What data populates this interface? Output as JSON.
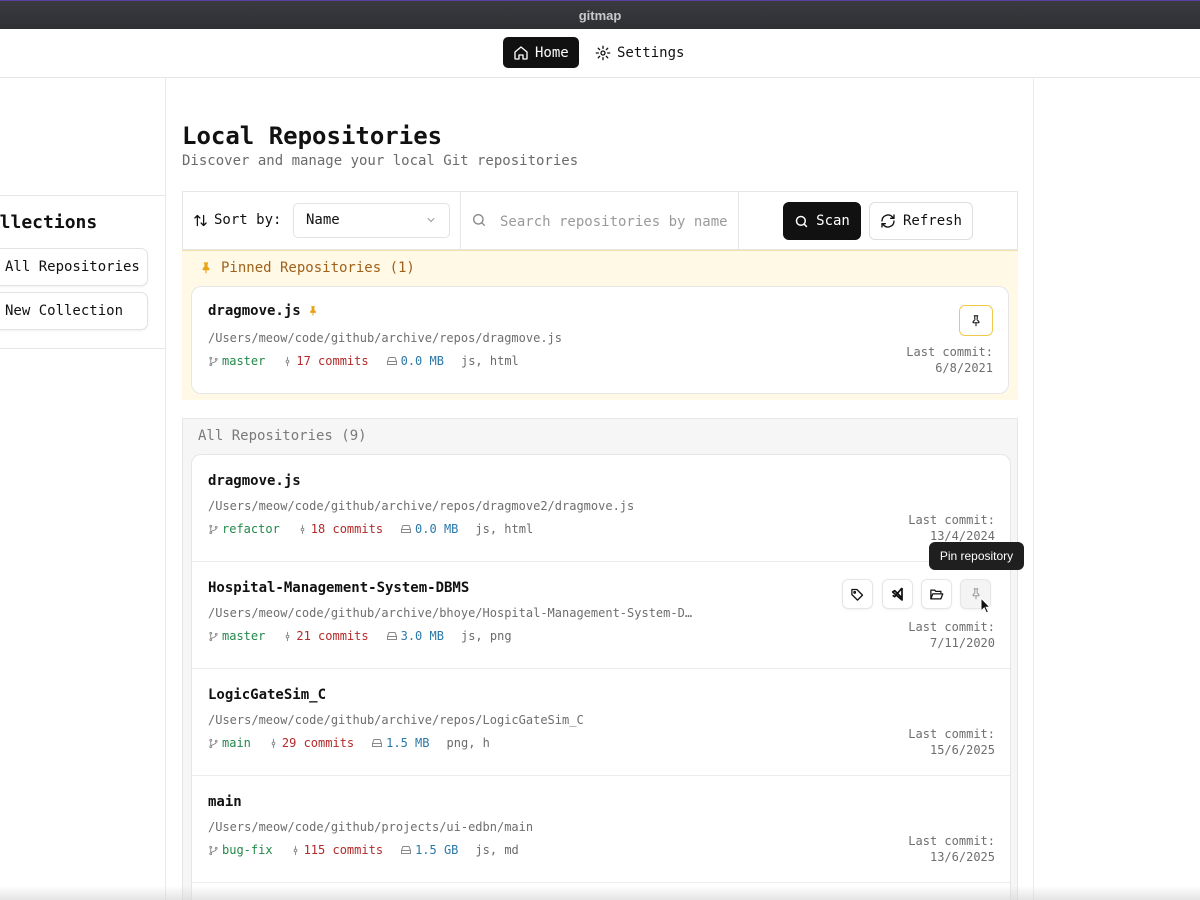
{
  "window": {
    "title": "gitmap"
  },
  "nav": {
    "home": "Home",
    "settings": "Settings"
  },
  "sidebar": {
    "collections_title": "Collections",
    "items": [
      "All Repositories",
      "New Collection"
    ]
  },
  "header": {
    "title": "Local Repositories",
    "subtitle": "Discover and manage your local Git repositories"
  },
  "toolbar": {
    "sort_label": "Sort by:",
    "sort_value": "Name",
    "search_placeholder": "Search repositories by name...",
    "scan_label": "Scan",
    "refresh_label": "Refresh"
  },
  "pinned": {
    "title": "Pinned Repositories (1)",
    "repos": [
      {
        "name": "dragmove.js",
        "path": "/Users/meow/code/github/archive/repos/dragmove.js",
        "branch": "master",
        "commits": "17 commits",
        "size": "0.0 MB",
        "types": "js, html",
        "last_commit_label": "Last commit:",
        "last_commit": "6/8/2021"
      }
    ]
  },
  "all": {
    "title": "All Repositories (9)",
    "repos": [
      {
        "name": "dragmove.js",
        "path": "/Users/meow/code/github/archive/repos/dragmove2/dragmove.js",
        "branch": "refactor",
        "commits": "18 commits",
        "size": "0.0 MB",
        "types": "js, html",
        "last_commit_label": "Last commit:",
        "last_commit": "13/4/2024"
      },
      {
        "name": "Hospital-Management-System-DBMS",
        "path": "/Users/meow/code/github/archive/bhoye/Hospital-Management-System-D…",
        "branch": "master",
        "commits": "21 commits",
        "size": "3.0 MB",
        "types": "js, png",
        "last_commit_label": "Last commit:",
        "last_commit": "7/11/2020"
      },
      {
        "name": "LogicGateSim_C",
        "path": "/Users/meow/code/github/archive/repos/LogicGateSim_C",
        "branch": "main",
        "commits": "29 commits",
        "size": "1.5 MB",
        "types": "png, h",
        "last_commit_label": "Last commit:",
        "last_commit": "15/6/2025"
      },
      {
        "name": "main",
        "path": "/Users/meow/code/github/projects/ui-edbn/main",
        "branch": "bug-fix",
        "commits": "115 commits",
        "size": "1.5 GB",
        "types": "js, md",
        "last_commit_label": "Last commit:",
        "last_commit": "13/6/2025"
      }
    ]
  },
  "tooltip": {
    "text": "Pin repository"
  },
  "colors": {
    "branch": "#23884a",
    "commits": "#b32a2a",
    "size": "#2a78a8",
    "pin": "#e8a317",
    "pinned_bg": "#fff9e6"
  },
  "icons": [
    "home-icon",
    "gear-icon",
    "sort-icon",
    "chevron-down-icon",
    "search-icon",
    "refresh-icon",
    "pin-icon",
    "branch-icon",
    "commit-icon",
    "disk-icon",
    "tag-icon",
    "vscode-icon",
    "folder-open-icon",
    "cursor-icon"
  ]
}
